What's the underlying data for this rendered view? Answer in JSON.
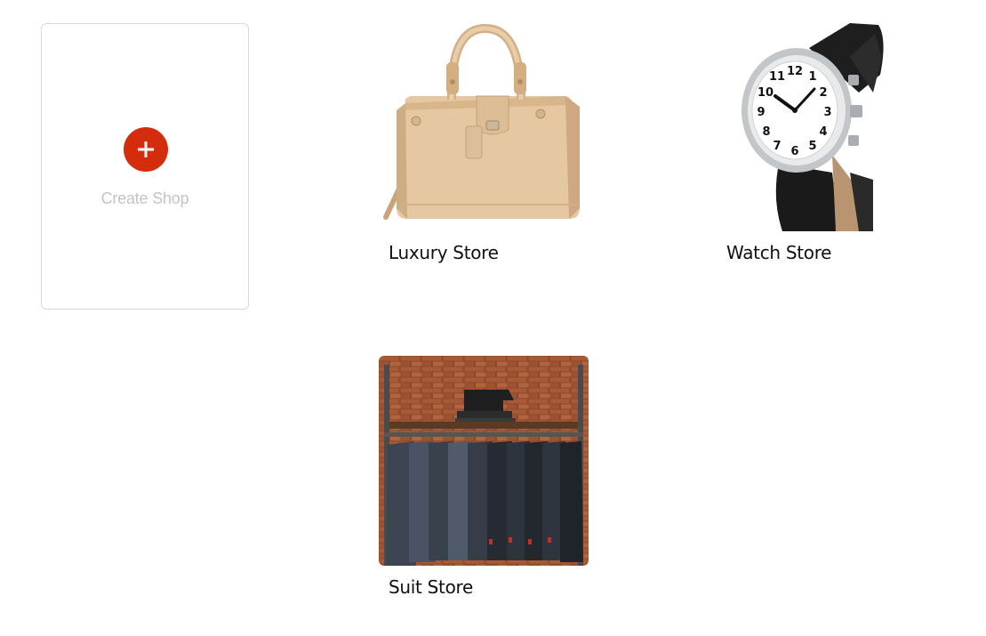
{
  "create_shop": {
    "label": "Create Shop",
    "icon": "plus-icon",
    "accent_color": "#d42d0e"
  },
  "stores": [
    {
      "name": "Luxury Store",
      "image": "handbag"
    },
    {
      "name": "Watch Store",
      "image": "wristwatch"
    },
    {
      "name": "Suit Store",
      "image": "suit-rack"
    }
  ]
}
